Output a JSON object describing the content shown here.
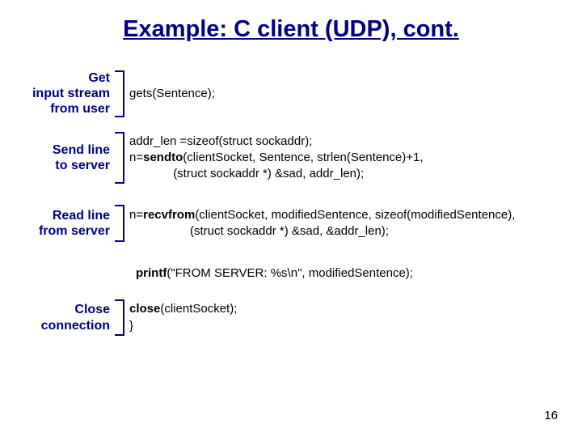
{
  "title": "Example: C client (UDP), cont.",
  "blocks": {
    "get": {
      "label": "Get\ninput stream\nfrom user",
      "code": "gets(Sentence);"
    },
    "send": {
      "label": "Send line\nto server",
      "code_l1": "addr_len =sizeof(struct sockaddr);",
      "code_l2a": "n=",
      "code_l2b": "sendto",
      "code_l2c": "(clientSocket, Sentence, strlen(Sentence)+1,",
      "code_l3": "             (struct sockaddr *) &sad, addr_len);"
    },
    "read": {
      "label": "Read line\nfrom server",
      "code_l1a": "n=",
      "code_l1b": "recvfrom",
      "code_l1c": "(clientSocket, modifiedSentence, sizeof(modifiedSentence),",
      "code_l2": "                  (struct sockaddr *) &sad, &addr_len);"
    },
    "printf": {
      "bold": "printf",
      "rest": "(\"FROM SERVER: %s\\n\", modifiedSentence);"
    },
    "close": {
      "label": "Close\nconnection",
      "code_bold": "close",
      "code_rest": "(clientSocket);",
      "code_l2": "}"
    }
  },
  "page_number": "16"
}
